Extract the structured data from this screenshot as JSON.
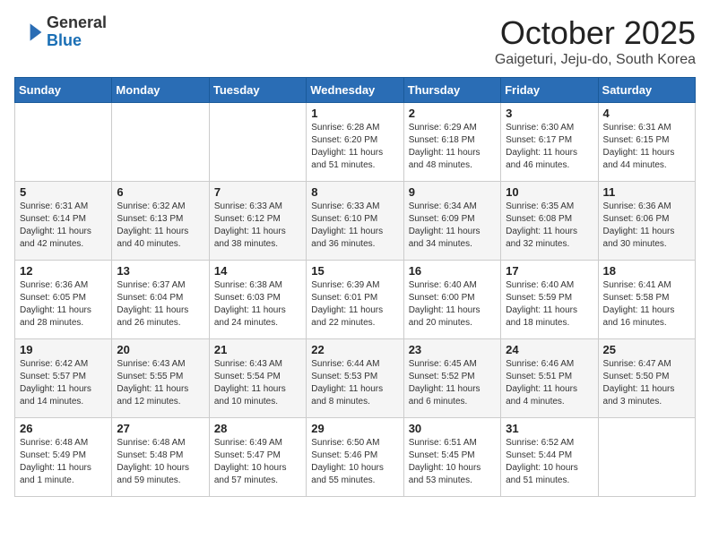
{
  "header": {
    "logo": {
      "line1": "General",
      "line2": "Blue"
    },
    "title": "October 2025",
    "subtitle": "Gaigeturi, Jeju-do, South Korea"
  },
  "weekdays": [
    "Sunday",
    "Monday",
    "Tuesday",
    "Wednesday",
    "Thursday",
    "Friday",
    "Saturday"
  ],
  "weeks": [
    [
      {
        "day": "",
        "info": ""
      },
      {
        "day": "",
        "info": ""
      },
      {
        "day": "",
        "info": ""
      },
      {
        "day": "1",
        "info": "Sunrise: 6:28 AM\nSunset: 6:20 PM\nDaylight: 11 hours\nand 51 minutes."
      },
      {
        "day": "2",
        "info": "Sunrise: 6:29 AM\nSunset: 6:18 PM\nDaylight: 11 hours\nand 48 minutes."
      },
      {
        "day": "3",
        "info": "Sunrise: 6:30 AM\nSunset: 6:17 PM\nDaylight: 11 hours\nand 46 minutes."
      },
      {
        "day": "4",
        "info": "Sunrise: 6:31 AM\nSunset: 6:15 PM\nDaylight: 11 hours\nand 44 minutes."
      }
    ],
    [
      {
        "day": "5",
        "info": "Sunrise: 6:31 AM\nSunset: 6:14 PM\nDaylight: 11 hours\nand 42 minutes."
      },
      {
        "day": "6",
        "info": "Sunrise: 6:32 AM\nSunset: 6:13 PM\nDaylight: 11 hours\nand 40 minutes."
      },
      {
        "day": "7",
        "info": "Sunrise: 6:33 AM\nSunset: 6:12 PM\nDaylight: 11 hours\nand 38 minutes."
      },
      {
        "day": "8",
        "info": "Sunrise: 6:33 AM\nSunset: 6:10 PM\nDaylight: 11 hours\nand 36 minutes."
      },
      {
        "day": "9",
        "info": "Sunrise: 6:34 AM\nSunset: 6:09 PM\nDaylight: 11 hours\nand 34 minutes."
      },
      {
        "day": "10",
        "info": "Sunrise: 6:35 AM\nSunset: 6:08 PM\nDaylight: 11 hours\nand 32 minutes."
      },
      {
        "day": "11",
        "info": "Sunrise: 6:36 AM\nSunset: 6:06 PM\nDaylight: 11 hours\nand 30 minutes."
      }
    ],
    [
      {
        "day": "12",
        "info": "Sunrise: 6:36 AM\nSunset: 6:05 PM\nDaylight: 11 hours\nand 28 minutes."
      },
      {
        "day": "13",
        "info": "Sunrise: 6:37 AM\nSunset: 6:04 PM\nDaylight: 11 hours\nand 26 minutes."
      },
      {
        "day": "14",
        "info": "Sunrise: 6:38 AM\nSunset: 6:03 PM\nDaylight: 11 hours\nand 24 minutes."
      },
      {
        "day": "15",
        "info": "Sunrise: 6:39 AM\nSunset: 6:01 PM\nDaylight: 11 hours\nand 22 minutes."
      },
      {
        "day": "16",
        "info": "Sunrise: 6:40 AM\nSunset: 6:00 PM\nDaylight: 11 hours\nand 20 minutes."
      },
      {
        "day": "17",
        "info": "Sunrise: 6:40 AM\nSunset: 5:59 PM\nDaylight: 11 hours\nand 18 minutes."
      },
      {
        "day": "18",
        "info": "Sunrise: 6:41 AM\nSunset: 5:58 PM\nDaylight: 11 hours\nand 16 minutes."
      }
    ],
    [
      {
        "day": "19",
        "info": "Sunrise: 6:42 AM\nSunset: 5:57 PM\nDaylight: 11 hours\nand 14 minutes."
      },
      {
        "day": "20",
        "info": "Sunrise: 6:43 AM\nSunset: 5:55 PM\nDaylight: 11 hours\nand 12 minutes."
      },
      {
        "day": "21",
        "info": "Sunrise: 6:43 AM\nSunset: 5:54 PM\nDaylight: 11 hours\nand 10 minutes."
      },
      {
        "day": "22",
        "info": "Sunrise: 6:44 AM\nSunset: 5:53 PM\nDaylight: 11 hours\nand 8 minutes."
      },
      {
        "day": "23",
        "info": "Sunrise: 6:45 AM\nSunset: 5:52 PM\nDaylight: 11 hours\nand 6 minutes."
      },
      {
        "day": "24",
        "info": "Sunrise: 6:46 AM\nSunset: 5:51 PM\nDaylight: 11 hours\nand 4 minutes."
      },
      {
        "day": "25",
        "info": "Sunrise: 6:47 AM\nSunset: 5:50 PM\nDaylight: 11 hours\nand 3 minutes."
      }
    ],
    [
      {
        "day": "26",
        "info": "Sunrise: 6:48 AM\nSunset: 5:49 PM\nDaylight: 11 hours\nand 1 minute."
      },
      {
        "day": "27",
        "info": "Sunrise: 6:48 AM\nSunset: 5:48 PM\nDaylight: 10 hours\nand 59 minutes."
      },
      {
        "day": "28",
        "info": "Sunrise: 6:49 AM\nSunset: 5:47 PM\nDaylight: 10 hours\nand 57 minutes."
      },
      {
        "day": "29",
        "info": "Sunrise: 6:50 AM\nSunset: 5:46 PM\nDaylight: 10 hours\nand 55 minutes."
      },
      {
        "day": "30",
        "info": "Sunrise: 6:51 AM\nSunset: 5:45 PM\nDaylight: 10 hours\nand 53 minutes."
      },
      {
        "day": "31",
        "info": "Sunrise: 6:52 AM\nSunset: 5:44 PM\nDaylight: 10 hours\nand 51 minutes."
      },
      {
        "day": "",
        "info": ""
      }
    ]
  ]
}
